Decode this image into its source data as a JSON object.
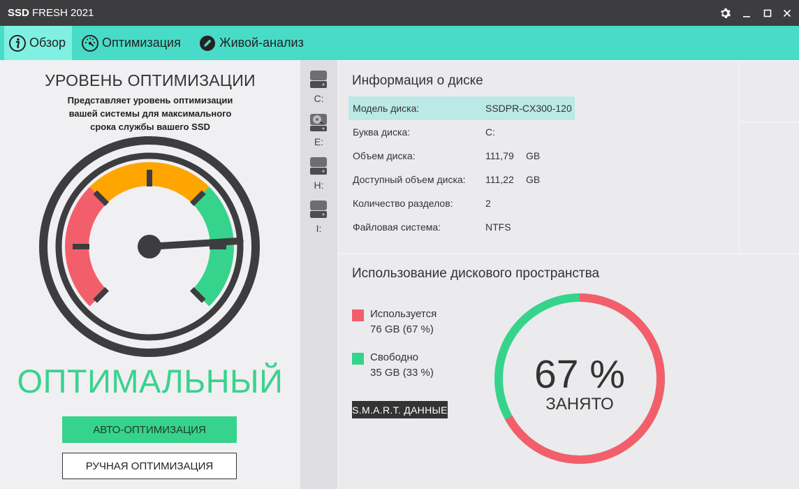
{
  "window": {
    "title_bold": "SSD",
    "title_rest": " FRESH 2021"
  },
  "colors": {
    "accent": "#48dcc8",
    "used": "#f25f6b",
    "free": "#36d38c",
    "gauge_mid": "#ffa500"
  },
  "nav": {
    "tabs": [
      {
        "label": "Обзор",
        "icon": "info-icon",
        "active": true
      },
      {
        "label": "Оптимизация",
        "icon": "speedometer-icon",
        "active": false
      },
      {
        "label": "Живой-анализ",
        "icon": "pencil-icon",
        "active": false
      }
    ]
  },
  "optimization": {
    "title": "УРОВЕНЬ ОПТИМИЗАЦИИ",
    "description": "Представляет уровень оптимизации вашей системы для максимального срока службы вашего SSD",
    "status": "ОПТИМАЛЬНЫЙ",
    "auto_button": "АВТО-ОПТИМИЗАЦИЯ",
    "manual_button": "РУЧНАЯ ОПТИМИЗАЦИЯ",
    "gauge_level": 0.82
  },
  "drives": [
    {
      "label": "C:",
      "icon": "ssd-drive-icon"
    },
    {
      "label": "E:",
      "icon": "hdd-drive-icon"
    },
    {
      "label": "H:",
      "icon": "ssd-drive-icon"
    },
    {
      "label": "I:",
      "icon": "ssd-drive-icon"
    }
  ],
  "disk_info": {
    "title": "Информация о диске",
    "rows": [
      {
        "key": "Модель диска:",
        "value": "SSDPR-CX300-120",
        "unit": ""
      },
      {
        "key": "Буква диска:",
        "value": "C:",
        "unit": ""
      },
      {
        "key": "Объем диска:",
        "value": "111,79",
        "unit": "GB"
      },
      {
        "key": "Доступный объем диска:",
        "value": "111,22",
        "unit": "GB"
      },
      {
        "key": "Количество разделов:",
        "value": "2",
        "unit": ""
      },
      {
        "key": "Файловая система:",
        "value": "NTFS",
        "unit": ""
      }
    ]
  },
  "usage": {
    "title": "Использование дискового пространства",
    "used_label": "Используется",
    "used_value": "76 GB (67 %)",
    "free_label": "Свободно",
    "free_value": "35 GB (33 %)",
    "smart_button": "S.M.A.R.T. ДАННЫЕ",
    "percent_text": "67 %",
    "percent_caption": "ЗАНЯТО",
    "used_fraction": 0.67
  }
}
